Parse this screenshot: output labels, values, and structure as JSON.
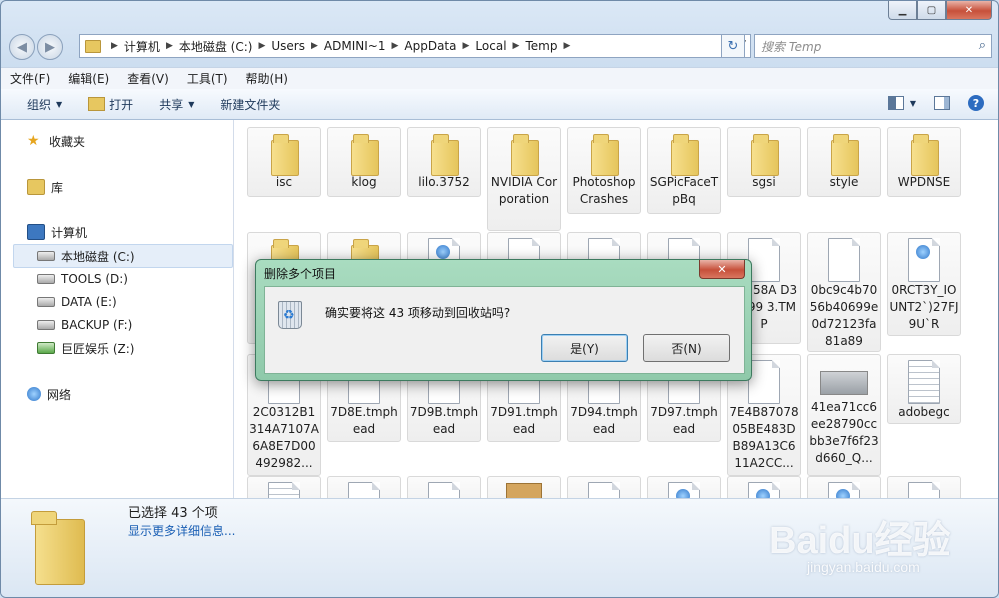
{
  "window": {
    "minimize_icon": "minimize-icon",
    "maximize_icon": "maximize-icon",
    "close_glyph": "✕"
  },
  "nav": {
    "back_glyph": "◀",
    "forward_glyph": "▶"
  },
  "address": {
    "segments": [
      "计算机",
      "本地磁盘 (C:)",
      "Users",
      "ADMINI~1",
      "AppData",
      "Local",
      "Temp"
    ],
    "separator": "▶",
    "refresh_glyph": "↻"
  },
  "search": {
    "placeholder": "搜索 Temp",
    "glyph": "⌕"
  },
  "menu": [
    "文件(F)",
    "编辑(E)",
    "查看(V)",
    "工具(T)",
    "帮助(H)"
  ],
  "toolbar": {
    "organize": "组织",
    "open": "打开",
    "share": "共享",
    "new_folder": "新建文件夹",
    "help_glyph": "?"
  },
  "sidebar": {
    "favorites": "收藏夹",
    "libraries": "库",
    "computer": "计算机",
    "drives": [
      "本地磁盘 (C:)",
      "TOOLS (D:)",
      "DATA (E:)",
      "BACKUP (F:)",
      "巨匠娱乐 (Z:)"
    ],
    "network": "网络"
  },
  "files": {
    "row1": [
      "isc",
      "klog",
      "lilo.3752",
      "NVIDIA Corporation",
      "PhotoshopCrashes",
      "SGPicFaceTpBq",
      "sgsi",
      "style",
      "WPDNSE"
    ],
    "row2_visible": [
      "F5158A D37B99 3.TMP",
      "0bc9c4b7056b40699e0d72123fa81a89",
      "0RCT3Y_IOUNT2`)27FJ9U`R"
    ],
    "row3": [
      "2C0312B1314A7107A6A8E7D00492982...",
      "7D8E.tmphead",
      "7D9B.tmphead",
      "7D91.tmphead",
      "7D94.tmphead",
      "7D97.tmphead",
      "7E4B8707805BE483DB89A13C611A2CC...",
      "41ea71cc6ee28790ccbb3e7f6f23d660_Q...",
      "adobegc"
    ]
  },
  "details": {
    "selected": "已选择 43 个项",
    "more": "显示更多详细信息..."
  },
  "dialog": {
    "title": "删除多个项目",
    "message": "确实要将这 43 项移动到回收站吗?",
    "yes": "是(Y)",
    "no": "否(N)",
    "close_glyph": "✕"
  },
  "watermark": {
    "brand": "Baidu经验",
    "url": "jingyan.baidu.com"
  }
}
